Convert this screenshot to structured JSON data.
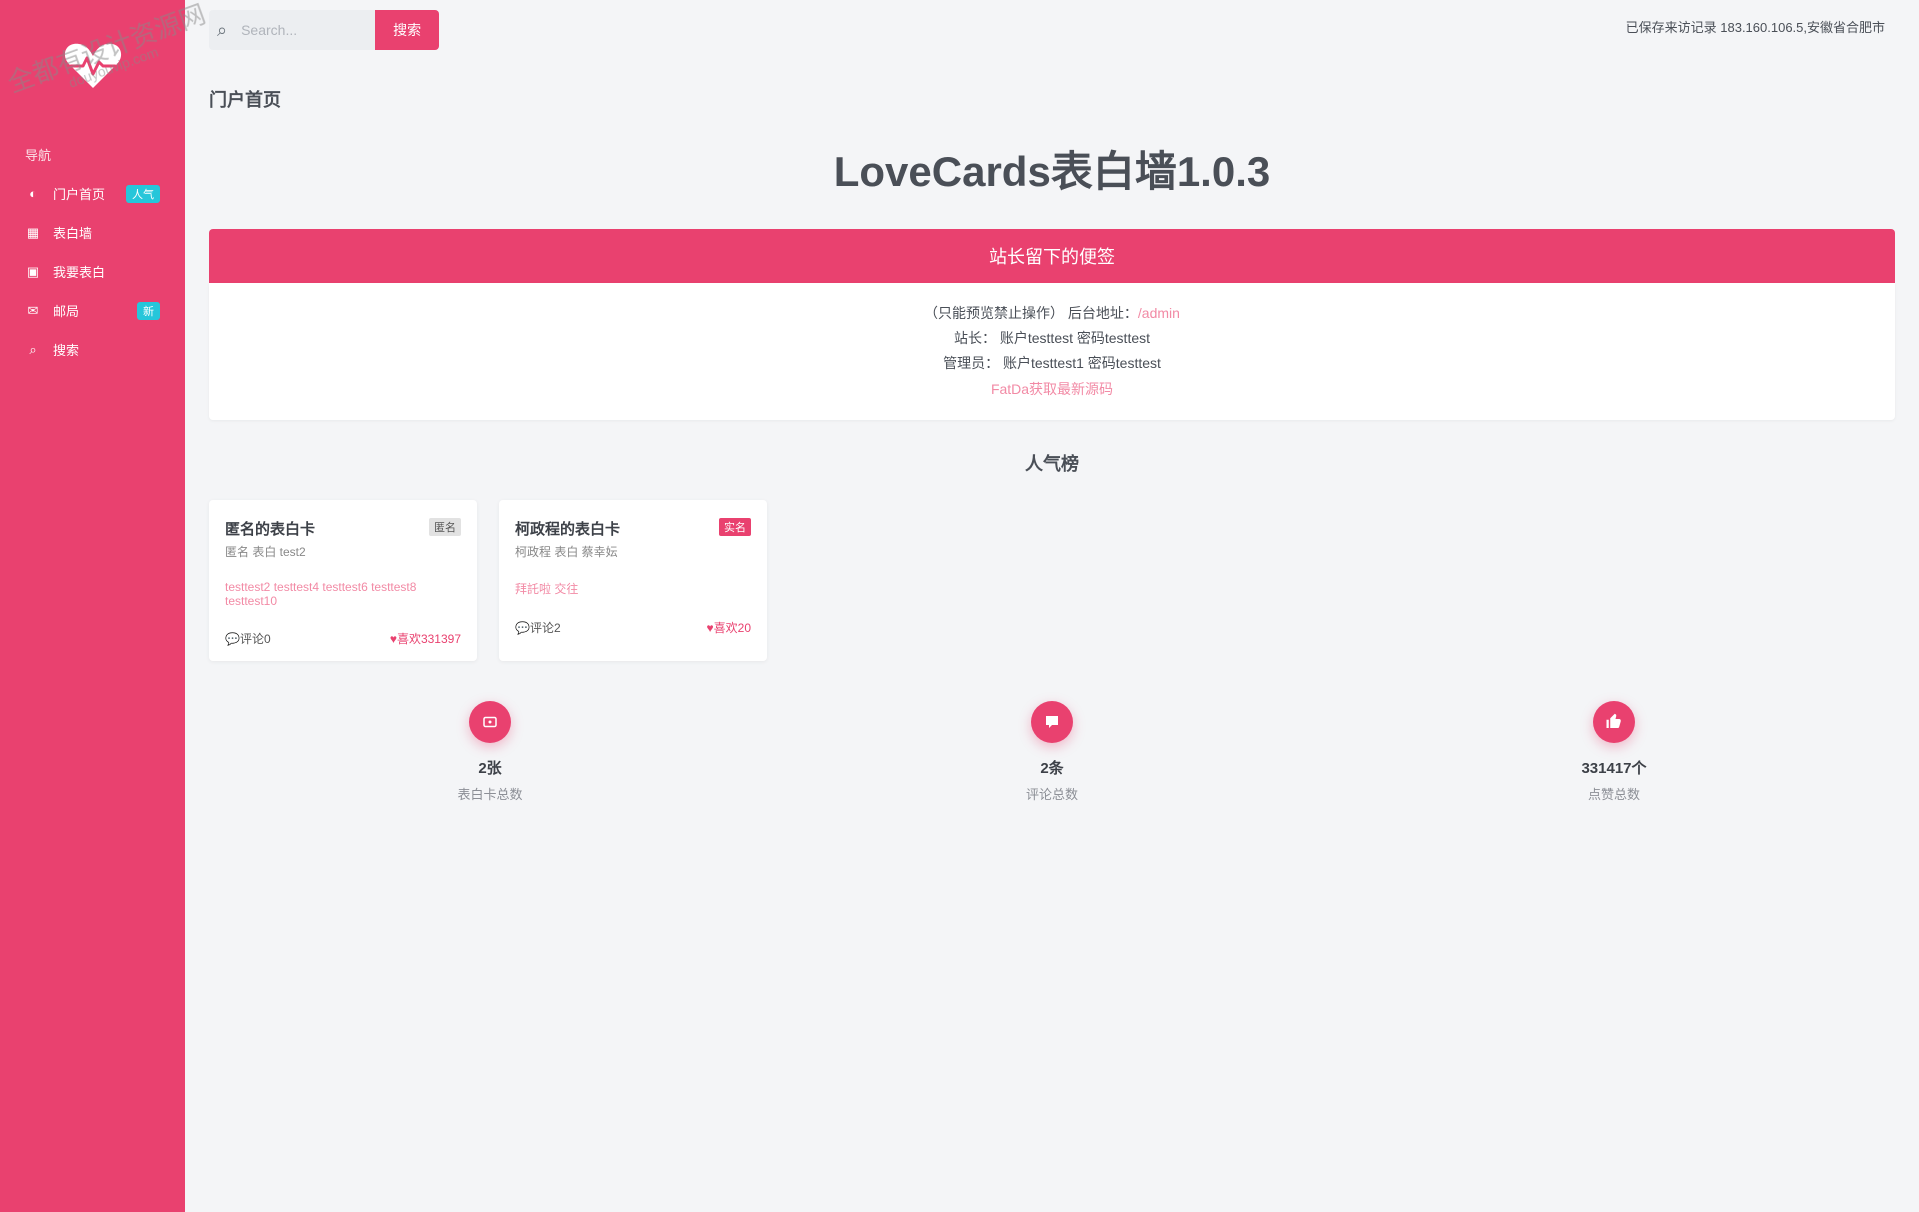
{
  "sidebar": {
    "section": "导航",
    "items": [
      {
        "label": "门户首页",
        "badge": "人气"
      },
      {
        "label": "表白墙",
        "badge": ""
      },
      {
        "label": "我要表白",
        "badge": ""
      },
      {
        "label": "邮局",
        "badge": "新"
      },
      {
        "label": "搜索",
        "badge": ""
      }
    ]
  },
  "topbar": {
    "search_placeholder": "Search...",
    "search_btn": "搜索",
    "visit_record": "已保存来访记录 183.160.106.5,安徽省合肥市"
  },
  "breadcrumb": "门户首页",
  "page_title": "LoveCards表白墙1.0.3",
  "note": {
    "title": "站长留下的便签",
    "l1a": "（只能预览禁止操作） 后台地址：",
    "l1b": "/admin",
    "l2": "站长： 账户testtest 密码testtest",
    "l3": "管理员： 账户testtest1 密码testtest",
    "l4": "FatDa获取最新源码"
  },
  "rank_title": "人气榜",
  "cards": [
    {
      "title": "匿名的表白卡",
      "badge": "匿名",
      "badge_cls": "",
      "sub": "匿名 表白 test2",
      "pink": "testtest2 testtest4 testtest6 testtest8 testtest10",
      "foot_left": "评论0",
      "foot_right": "喜欢331397"
    },
    {
      "title": "柯政程的表白卡",
      "badge": "实名",
      "badge_cls": "pink",
      "sub": "柯政程 表白 蔡幸妘",
      "pink": "拜託啦 交往",
      "foot_left": "评论2",
      "foot_right": "喜欢20"
    }
  ],
  "stats": [
    {
      "num": "2张",
      "label": "表白卡总数"
    },
    {
      "num": "2条",
      "label": "评论总数"
    },
    {
      "num": "331417个",
      "label": "点赞总数"
    }
  ],
  "watermark": {
    "l1": "全都有设计资源网",
    "l2": "douyouvip.com"
  }
}
